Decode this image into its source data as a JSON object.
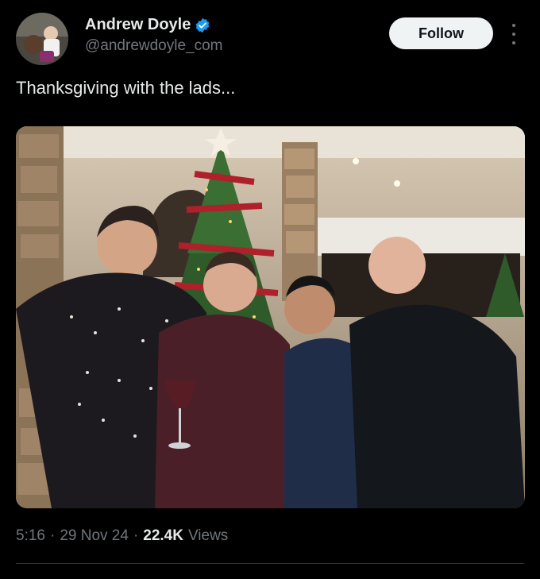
{
  "author": {
    "name": "Andrew Doyle",
    "handle": "@andrewdoyle_com",
    "verified": true
  },
  "follow_label": "Follow",
  "tweet": {
    "text": "Thanksgiving with the lads...",
    "time": "5:16",
    "date": "29 Nov 24",
    "views_count": "22.4K",
    "views_label": "Views",
    "sep": "·"
  },
  "colors": {
    "background": "#000000",
    "text": "#e7e9ea",
    "muted": "#71767b",
    "verified_blue": "#1d9bf0"
  },
  "icons": {
    "verified": "verified-badge-icon",
    "more": "more-options-icon"
  }
}
